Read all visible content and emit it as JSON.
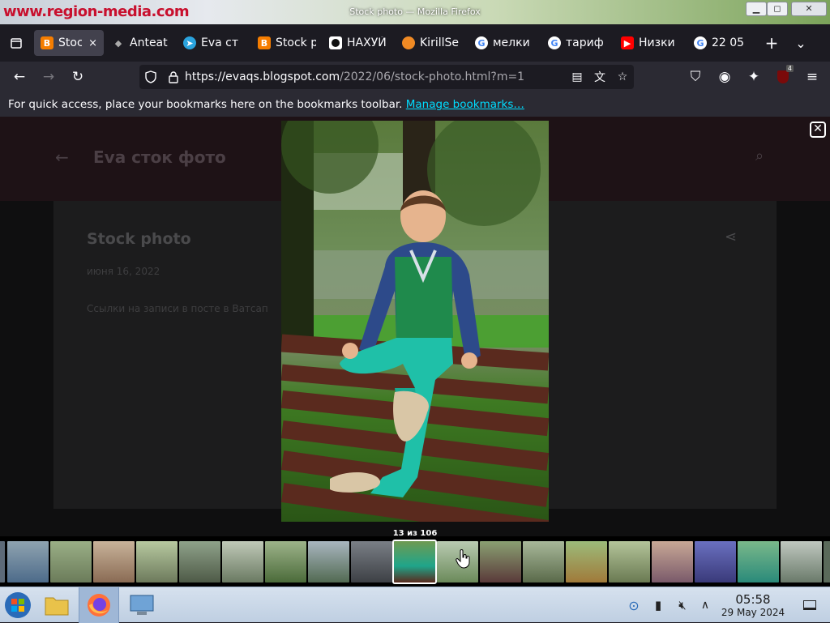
{
  "window": {
    "title": "Stock photo — Mozilla Firefox",
    "background_site_logo": "www.region-media.com",
    "controls": [
      "minimize",
      "maximize",
      "close"
    ]
  },
  "tabs": [
    {
      "label": "Stock p",
      "icon": "blogger-icon",
      "active": true,
      "close_label": "×"
    },
    {
      "label": "Anteat",
      "icon": "anteater-icon",
      "active": false
    },
    {
      "label": "Eva ст",
      "icon": "telegram-icon",
      "active": false
    },
    {
      "label": "Stock p",
      "icon": "blogger-icon",
      "active": false
    },
    {
      "label": "НАХУЙ",
      "icon": "dark-square-icon",
      "active": false
    },
    {
      "label": "KirillSe",
      "icon": "ball-icon",
      "active": false
    },
    {
      "label": "мелки",
      "icon": "google-icon",
      "active": false
    },
    {
      "label": "тариф",
      "icon": "google-icon",
      "active": false
    },
    {
      "label": "Низки",
      "icon": "youtube-icon",
      "active": false
    },
    {
      "label": "22 05",
      "icon": "google-icon",
      "active": false
    }
  ],
  "navbar": {
    "url_host": "https://evaqs.blogspot.com",
    "url_path": "/2022/06/stock-photo.html?m=1",
    "extension_badge": "4"
  },
  "bookmarks_bar": {
    "text": "For quick access, place your bookmarks here on the bookmarks toolbar.",
    "link": "Manage bookmarks…"
  },
  "page": {
    "blog_title": "Eva сток фото",
    "post_title": "Stock photo",
    "post_date": "июня 16, 2022",
    "post_note": "Ссылки на записи в посте в Ватсап"
  },
  "lightbox": {
    "counter": "13 из 106",
    "current_index": 13,
    "total": 106,
    "close_symbol": "✕",
    "thumbnail_count": 19,
    "selected_thumbnail": 9
  },
  "taskbar": {
    "time": "05:58",
    "date": "29 May 2024"
  },
  "colors": {
    "accent_link": "#00ddff",
    "tab_active": "#42414d",
    "toolbar": "#2b2a33",
    "tabstrip": "#1c1b22"
  }
}
